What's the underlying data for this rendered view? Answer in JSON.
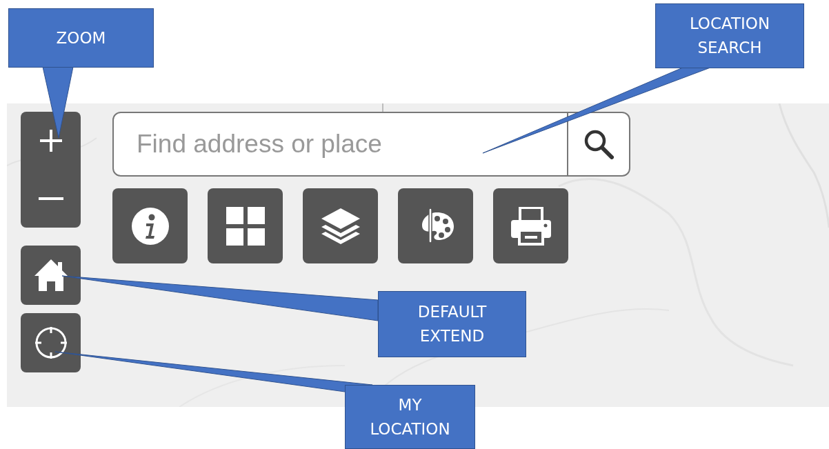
{
  "zoom_controls": [
    {
      "kind": "zoom-in"
    },
    {
      "kind": "zoom-out"
    }
  ],
  "search": {
    "placeholder": "Find address or place"
  },
  "tools": [
    {
      "kind": "info"
    },
    {
      "kind": "grid"
    },
    {
      "kind": "layers"
    },
    {
      "kind": "palette"
    },
    {
      "kind": "print"
    }
  ],
  "side_buttons": [
    {
      "kind": "home"
    },
    {
      "kind": "locate"
    }
  ],
  "callouts": [
    {
      "kind": "zoom",
      "lines": [
        "ZOOM"
      ]
    },
    {
      "kind": "search",
      "lines": [
        "LOCATION",
        "SEARCH"
      ]
    },
    {
      "kind": "home",
      "lines": [
        "DEFAULT",
        "EXTEND"
      ]
    },
    {
      "kind": "locate",
      "lines": [
        "MY",
        "LOCATION"
      ]
    }
  ]
}
